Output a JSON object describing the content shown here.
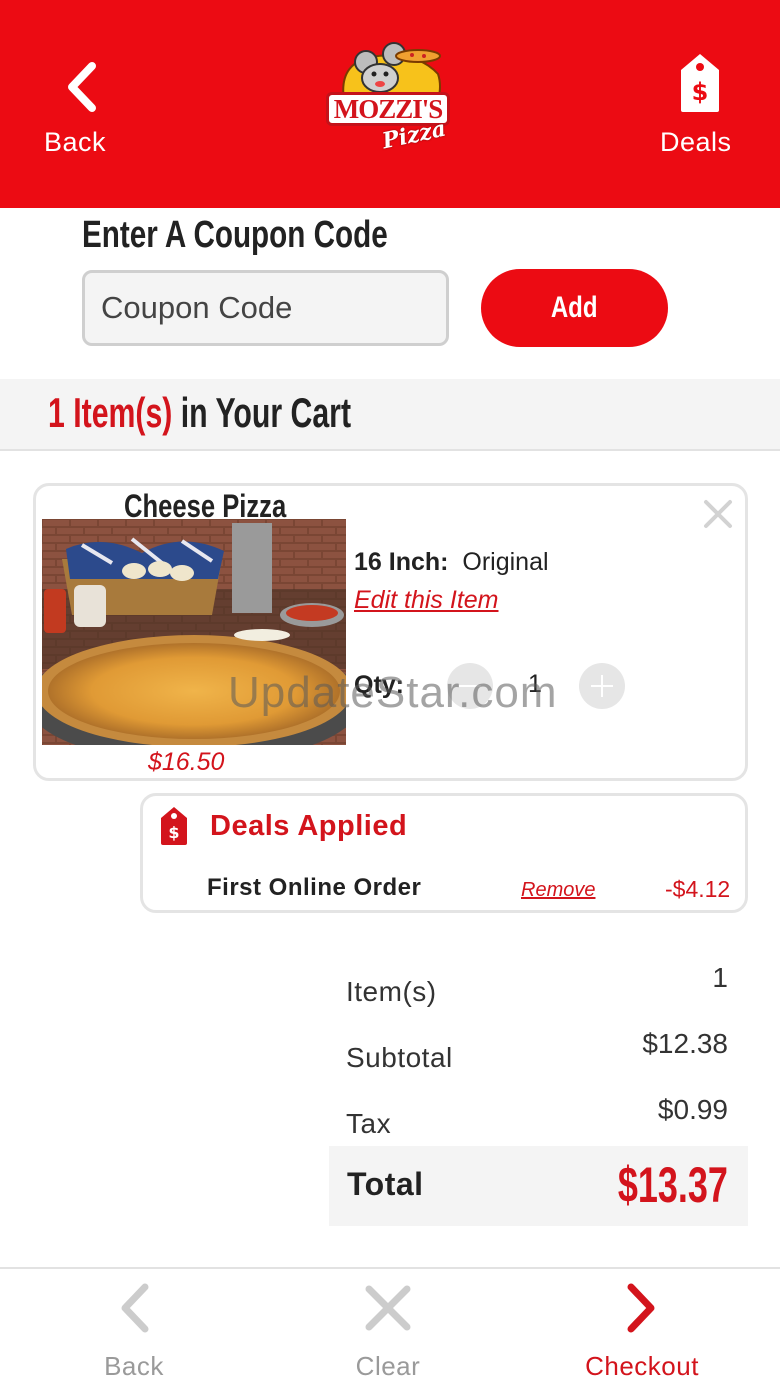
{
  "header": {
    "back_label": "Back",
    "deals_label": "Deals",
    "logo_text": "MOZZI'S",
    "logo_sub": "Pizza",
    "brand_color": "#ec0b13"
  },
  "coupon": {
    "title": "Enter A Coupon Code",
    "placeholder": "Coupon Code",
    "value": "",
    "add_label": "Add"
  },
  "cart": {
    "count_text": "1 Item(s)",
    "rest_text": " in Your Cart"
  },
  "item": {
    "name": "Cheese Pizza",
    "price": "$16.50",
    "size_label": "16 Inch:",
    "size_value": "Original",
    "edit_label": "Edit this Item",
    "qty_label": "Qty:",
    "qty_value": "1",
    "close_icon": "close-icon"
  },
  "watermark": "UpdateStar.com",
  "deals": {
    "title": "Deals Applied",
    "icon": "price-tag-icon",
    "entries": [
      {
        "name": "First Online Order",
        "remove_label": "Remove",
        "amount": "-$4.12"
      }
    ]
  },
  "summary": {
    "items_label": "Item(s)",
    "items_value": "1",
    "subtotal_label": "Subtotal",
    "subtotal_value": "$12.38",
    "tax_label": "Tax",
    "tax_value": "$0.99",
    "total_label": "Total",
    "total_value": "$13.37"
  },
  "footer": {
    "back_label": "Back",
    "clear_label": "Clear",
    "checkout_label": "Checkout",
    "accent_color": "#d3141c",
    "disabled_color": "#cccccc"
  }
}
